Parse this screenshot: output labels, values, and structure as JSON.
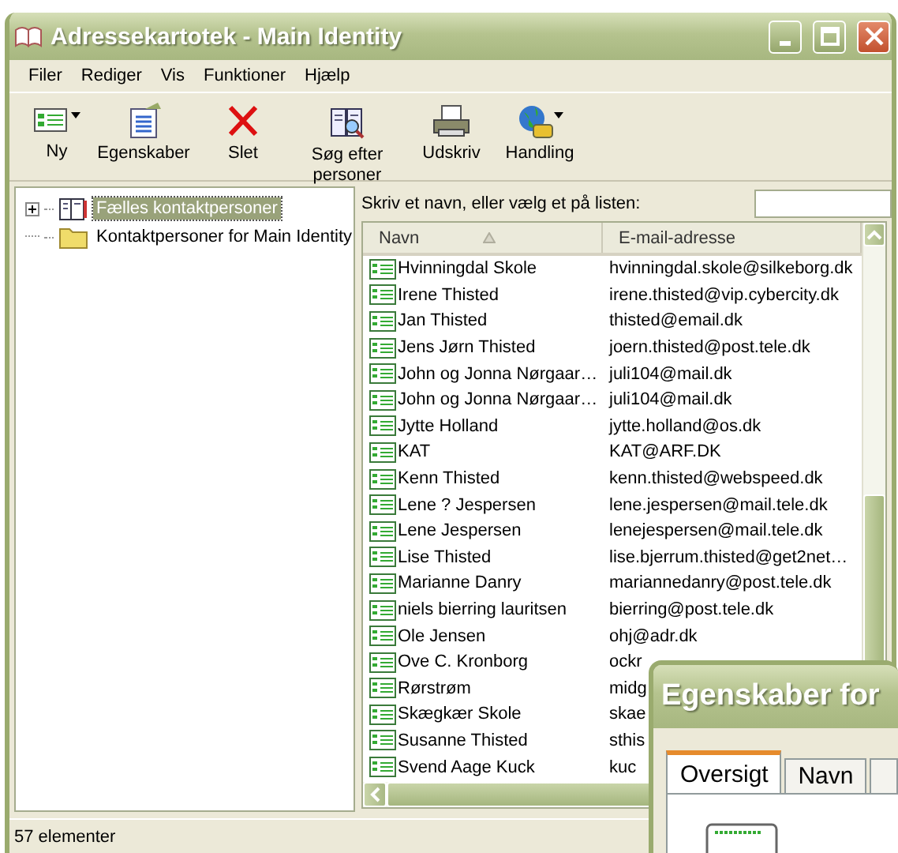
{
  "window": {
    "title": "Adressekartotek - Main Identity"
  },
  "menu": [
    "Filer",
    "Rediger",
    "Vis",
    "Funktioner",
    "Hjælp"
  ],
  "toolbar": [
    {
      "label": "Ny",
      "kind": "new-contact",
      "dropdown": true
    },
    {
      "label": "Egenskaber",
      "kind": "properties",
      "dropdown": false
    },
    {
      "label": "Slet",
      "kind": "delete",
      "dropdown": false
    },
    {
      "label": "Søg efter personer",
      "kind": "find",
      "dropdown": false
    },
    {
      "label": "Udskriv",
      "kind": "print",
      "dropdown": false
    },
    {
      "label": "Handling",
      "kind": "action",
      "dropdown": true
    }
  ],
  "tree": [
    {
      "label": "Fælles kontaktpersoner",
      "kind": "address-book",
      "expandable": true,
      "selected": true
    },
    {
      "label": "Kontaktpersoner for Main Identity",
      "kind": "folder",
      "expandable": false,
      "selected": false
    }
  ],
  "search": {
    "label": "Skriv et navn, eller vælg et på listen:"
  },
  "table": {
    "columns": [
      {
        "label": "Navn",
        "sorted": true
      },
      {
        "label": "E-mail-adresse",
        "sorted": false
      }
    ],
    "rows": [
      {
        "name": "Hvinningdal Skole",
        "email": "hvinningdal.skole@silkeborg.dk"
      },
      {
        "name": "Irene Thisted",
        "email": "irene.thisted@vip.cybercity.dk"
      },
      {
        "name": "Jan Thisted",
        "email": "thisted@email.dk"
      },
      {
        "name": "Jens Jørn Thisted",
        "email": "joern.thisted@post.tele.dk"
      },
      {
        "name": "John og Jonna Nørgaar…",
        "email": "juli104@mail.dk"
      },
      {
        "name": "John og Jonna Nørgaar…",
        "email": "juli104@mail.dk"
      },
      {
        "name": "Jytte Holland",
        "email": "jytte.holland@os.dk"
      },
      {
        "name": "KAT",
        "email": "KAT@ARF.DK"
      },
      {
        "name": "Kenn Thisted",
        "email": "kenn.thisted@webspeed.dk"
      },
      {
        "name": "Lene ? Jespersen",
        "email": "lene.jespersen@mail.tele.dk"
      },
      {
        "name": "Lene Jespersen",
        "email": "lenejespersen@mail.tele.dk"
      },
      {
        "name": "Lise Thisted",
        "email": "lise.bjerrum.thisted@get2net…"
      },
      {
        "name": "Marianne Danry",
        "email": "mariannedanry@post.tele.dk"
      },
      {
        "name": "niels bierring lauritsen",
        "email": "bierring@post.tele.dk"
      },
      {
        "name": "Ole Jensen",
        "email": "ohj@adr.dk"
      },
      {
        "name": "Ove C. Kronborg",
        "email": "ockr"
      },
      {
        "name": "Rørstrøm",
        "email": "midg"
      },
      {
        "name": "Skægkær Skole",
        "email": "skae"
      },
      {
        "name": "Susanne Thisted",
        "email": "sthis"
      },
      {
        "name": "Svend Aage Kuck",
        "email": "kuc"
      }
    ]
  },
  "status_bar": "57 elementer",
  "dialog": {
    "title": "Egenskaber for",
    "tabs": [
      {
        "label": "Oversigt",
        "selected": true
      },
      {
        "label": "Navn",
        "selected": false
      },
      {
        "selected": false
      }
    ]
  }
}
